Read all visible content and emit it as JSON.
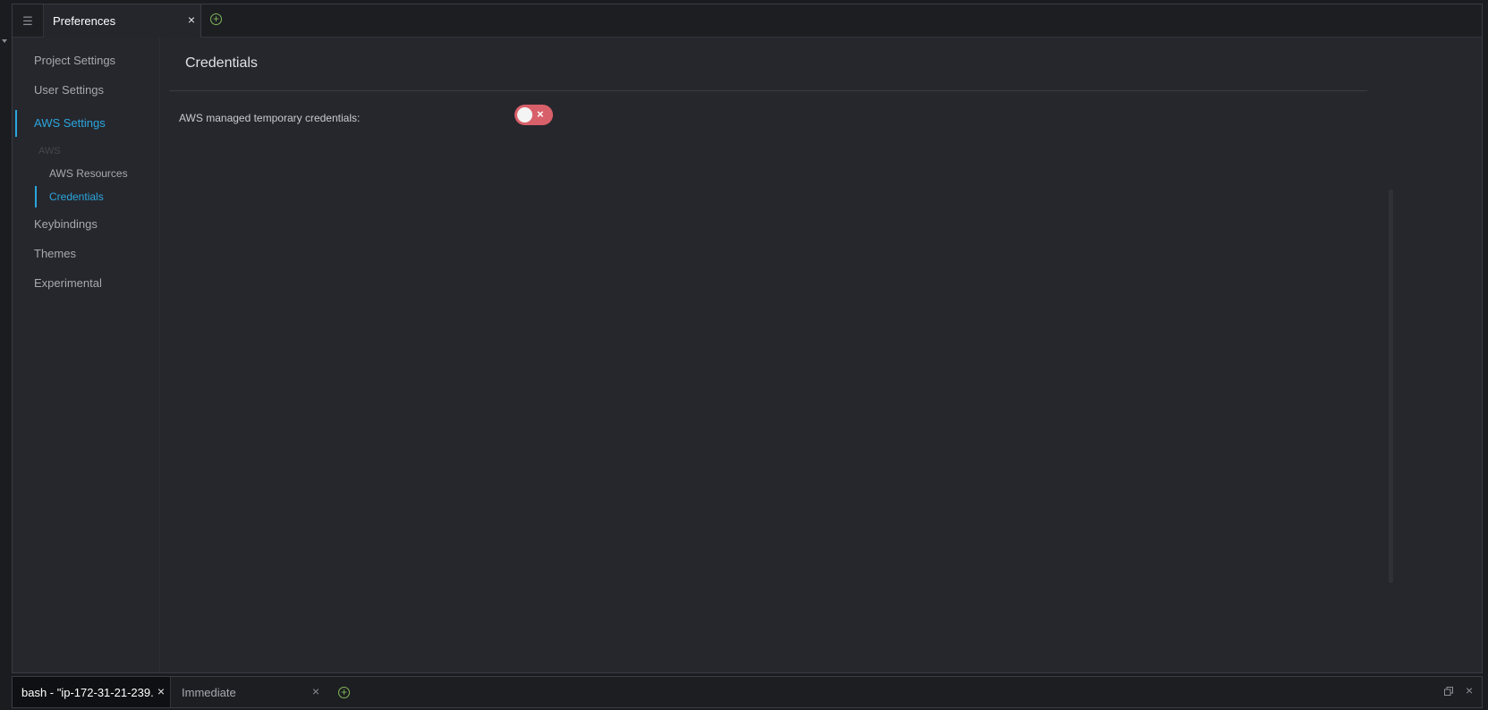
{
  "tabbar": {
    "menu_icon": "☰",
    "active_tab": "Preferences",
    "close_glyph": "×",
    "add_glyph": "+"
  },
  "sidebar": {
    "items": [
      {
        "label": "Project Settings"
      },
      {
        "label": "User Settings"
      },
      {
        "label": "AWS Settings",
        "active": true
      },
      {
        "label": "Keybindings"
      },
      {
        "label": "Themes"
      },
      {
        "label": "Experimental"
      }
    ],
    "group_label": "AWS",
    "sub_items": [
      {
        "label": "AWS Resources"
      },
      {
        "label": "Credentials",
        "active": true
      }
    ]
  },
  "content": {
    "title": "Credentials",
    "setting_label": "AWS managed temporary credentials:",
    "toggle_state": "off",
    "toggle_glyph": "×"
  },
  "bottom": {
    "tabs": [
      {
        "label": "bash - \"ip-172-31-21-239.",
        "active": true
      },
      {
        "label": "Immediate"
      }
    ],
    "close_glyph": "×",
    "add_glyph": "+"
  },
  "colors": {
    "accent": "#2aa6de",
    "toggle_off": "#d8606a",
    "add_green": "#7fb85a",
    "background": "#26272d"
  }
}
